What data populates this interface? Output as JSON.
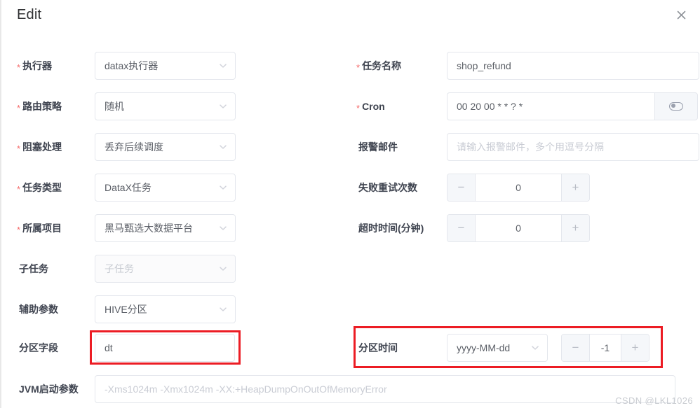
{
  "dialog": {
    "title": "Edit",
    "close_icon": "close-icon"
  },
  "watermark": "CSDN @LKL1026",
  "fields": {
    "executor": {
      "label": "执行器",
      "required": "*",
      "value": "datax执行器"
    },
    "route_policy": {
      "label": "路由策略",
      "required": "*",
      "value": "随机"
    },
    "block_strategy": {
      "label": "阻塞处理",
      "required": "*",
      "value": "丢弃后续调度"
    },
    "task_type": {
      "label": "任务类型",
      "required": "*",
      "value": "DataX任务"
    },
    "project": {
      "label": "所属项目",
      "required": "*",
      "value": "黑马甄选大数据平台"
    },
    "sub_task": {
      "label": "子任务",
      "required": "",
      "placeholder": "子任务"
    },
    "aux_param": {
      "label": "辅助参数",
      "required": "",
      "value": "HIVE分区"
    },
    "partition_field": {
      "label": "分区字段",
      "required": "",
      "value": "dt"
    },
    "jvm_args": {
      "label": "JVM启动参数",
      "required": "",
      "placeholder": "-Xms1024m -Xmx1024m -XX:+HeapDumpOnOutOfMemoryError"
    },
    "task_name": {
      "label": "任务名称",
      "required": "*",
      "value": "shop_refund"
    },
    "cron": {
      "label": "Cron",
      "required": "*",
      "value": "00 20 00 * * ? *",
      "suffix_icon": "cron-toggle-icon"
    },
    "alarm_email": {
      "label": "报警邮件",
      "required": "",
      "placeholder": "请输入报警邮件，多个用逗号分隔"
    },
    "retry_count": {
      "label": "失败重试次数",
      "required": "",
      "value": "0",
      "minus": "−",
      "plus": "+"
    },
    "timeout": {
      "label": "超时时间(分钟)",
      "required": "",
      "value": "0",
      "minus": "−",
      "plus": "+"
    },
    "partition_time": {
      "label": "分区时间",
      "required": "",
      "format": "yyyy-MM-dd",
      "offset": "-1",
      "minus": "−",
      "plus": "+"
    }
  },
  "colors": {
    "accent_required": "#f56c6c",
    "highlight_box": "#ec1c24",
    "border": "#e4e7ed"
  }
}
